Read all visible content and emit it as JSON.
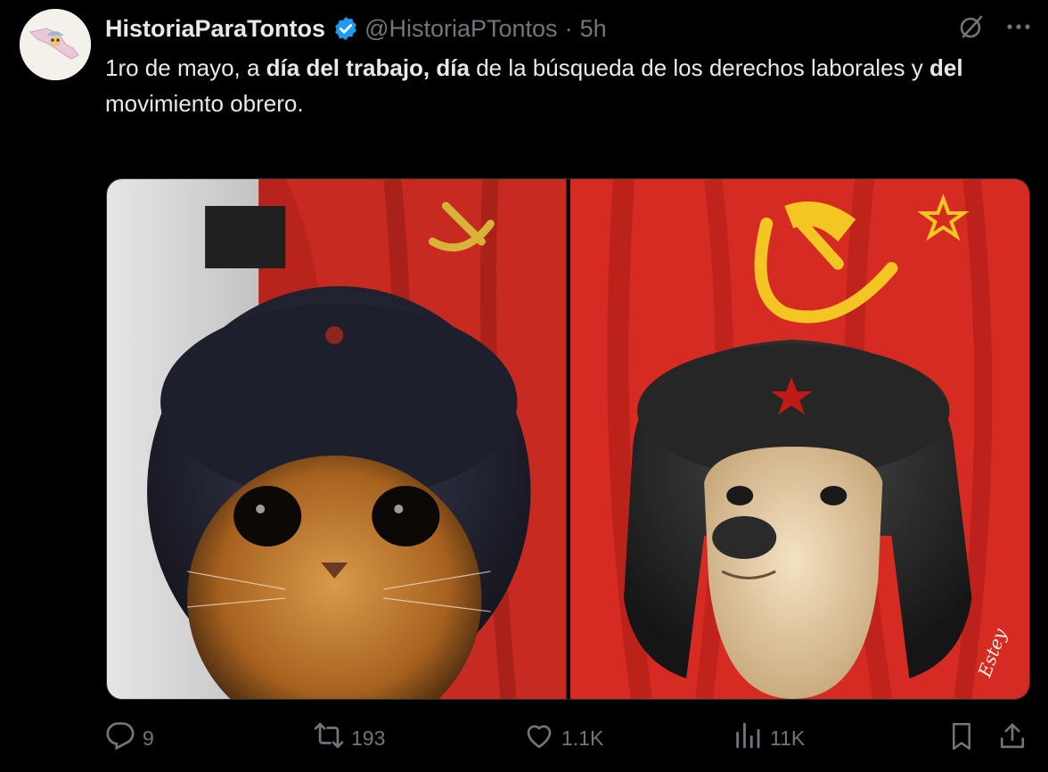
{
  "author": {
    "name": "HistoriaParaTontos",
    "handle": "@HistoriaPTontos",
    "separator": "·",
    "time": "5h"
  },
  "tweet": {
    "seg1": "1ro de mayo, a ",
    "seg2": "día del trabajo,",
    "seg3": " ",
    "seg4": "día",
    "seg5": " de la búsqueda de los derechos laborales y ",
    "seg6": "del",
    "seg7": "movimiento obrero."
  },
  "media": {
    "signature": "Estey"
  },
  "actions": {
    "replies": "9",
    "reposts": "193",
    "likes": "1.1K",
    "views": "11K"
  },
  "icons": {
    "verified": "verified-badge-icon",
    "grok": "grok-icon",
    "more": "more-icon",
    "reply": "reply-icon",
    "repost": "repost-icon",
    "like": "like-icon",
    "views": "views-icon",
    "bookmark": "bookmark-icon",
    "share": "share-icon"
  },
  "colors": {
    "verified": "#1d9bf0",
    "muted": "#71767b",
    "text": "#e7e9ea",
    "flag_red": "#d62b22",
    "emblem_yellow": "#f3c623"
  }
}
